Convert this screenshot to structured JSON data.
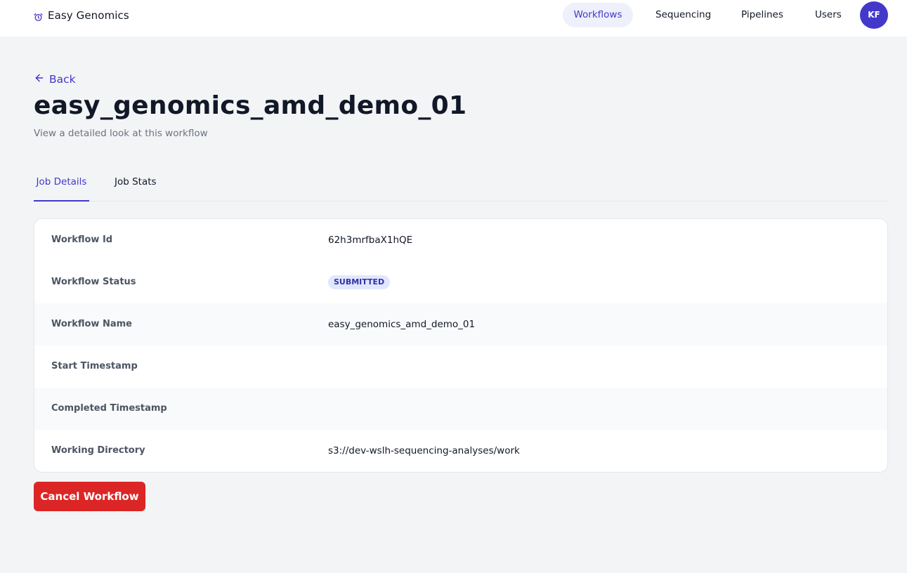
{
  "app": {
    "name": "Easy Genomics",
    "brand_icon": "alarm-clock-icon",
    "accent_color": "#4338ca"
  },
  "nav": {
    "items": [
      {
        "label": "Workflows",
        "active": true
      },
      {
        "label": "Sequencing",
        "active": false
      },
      {
        "label": "Pipelines",
        "active": false
      },
      {
        "label": "Users",
        "active": false
      }
    ],
    "avatar_initials": "KF"
  },
  "header": {
    "back_label": "Back",
    "title": "easy_genomics_amd_demo_01",
    "subtitle": "View a detailed look at this workflow"
  },
  "tabs": [
    {
      "label": "Job Details",
      "active": true
    },
    {
      "label": "Job Stats",
      "active": false
    }
  ],
  "details": {
    "workflow_id": {
      "label": "Workflow Id",
      "value": "62h3mrfbaX1hQE"
    },
    "workflow_status": {
      "label": "Workflow Status",
      "value": "SUBMITTED"
    },
    "workflow_name": {
      "label": "Workflow Name",
      "value": "easy_genomics_amd_demo_01"
    },
    "start_timestamp": {
      "label": "Start Timestamp",
      "value": ""
    },
    "completed_timestamp": {
      "label": "Completed Timestamp",
      "value": ""
    },
    "working_directory": {
      "label": "Working Directory",
      "value": "s3://dev-wslh-sequencing-analyses/work"
    }
  },
  "actions": {
    "cancel_label": "Cancel Workflow",
    "cancel_color": "#dc2626"
  }
}
